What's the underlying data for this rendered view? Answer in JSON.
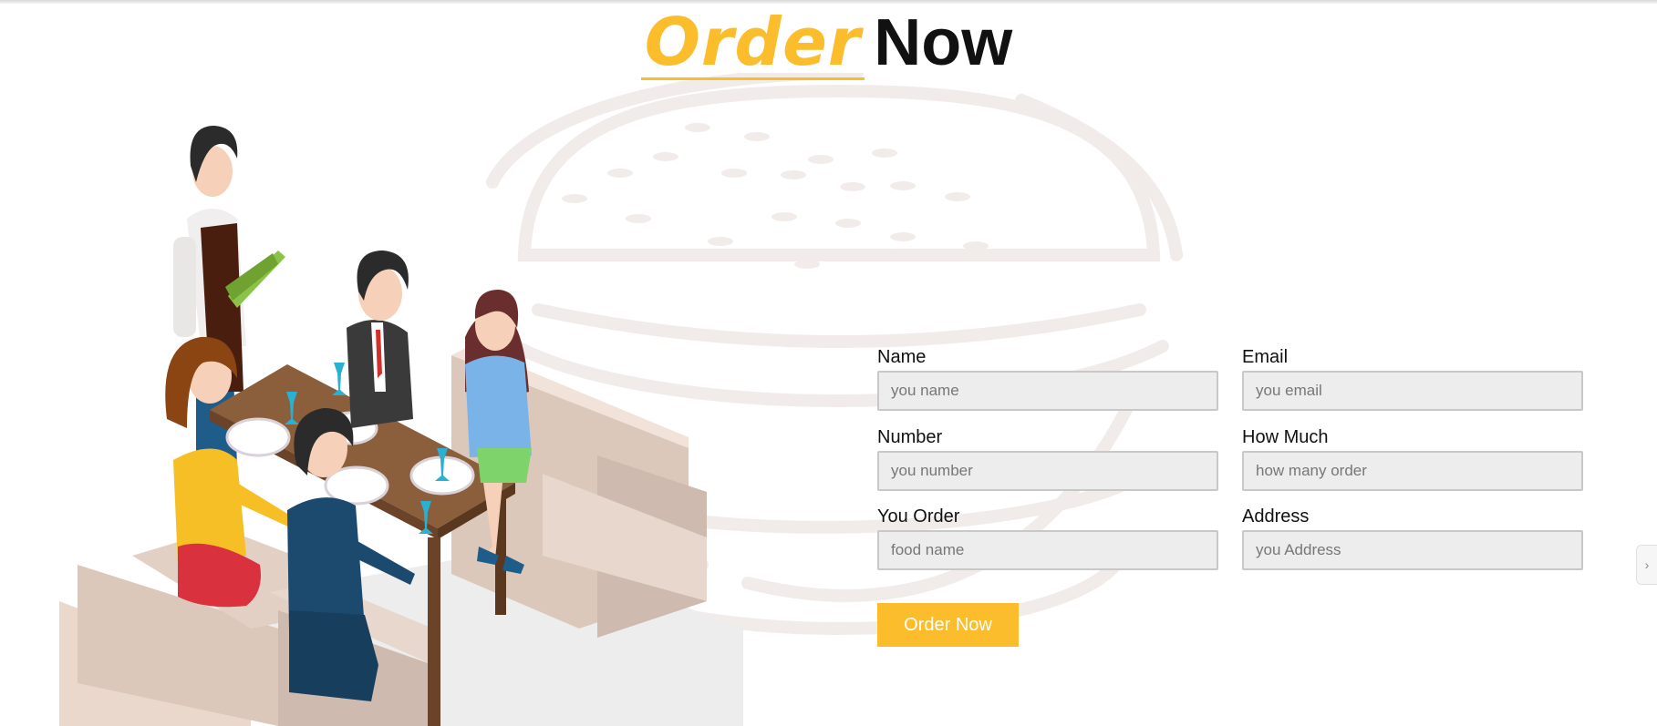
{
  "heading": {
    "word1": "Order",
    "word2": "Now"
  },
  "form": {
    "fields": [
      {
        "label": "Name",
        "placeholder": "you name",
        "value": ""
      },
      {
        "label": "Email",
        "placeholder": "you email",
        "value": ""
      },
      {
        "label": "Number",
        "placeholder": "you number",
        "value": ""
      },
      {
        "label": "How Much",
        "placeholder": "how many order",
        "value": ""
      },
      {
        "label": "You Order",
        "placeholder": "food name",
        "value": ""
      },
      {
        "label": "Address",
        "placeholder": "you Address",
        "value": ""
      }
    ],
    "submit_label": "Order Now"
  },
  "side_tab": {
    "icon": "chevron-right-icon",
    "glyph": "›"
  },
  "colors": {
    "accent": "#fbbd2c",
    "heading_dark": "#111111",
    "input_bg": "#ededed",
    "input_border": "#c8c8c8",
    "watermark": "#f1ecea"
  },
  "icons": {
    "background": "burger-watermark-icon",
    "illustration": "restaurant-dining-illustration"
  }
}
